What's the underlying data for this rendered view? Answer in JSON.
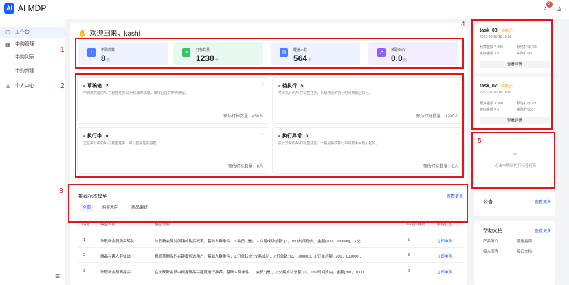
{
  "app": {
    "logo": "AI",
    "name": "AI MDP",
    "notify_count": "2"
  },
  "sidebar": {
    "items": [
      {
        "label": "工作台",
        "icon": "clock-icon"
      },
      {
        "label": "申购管理",
        "icon": "grid-icon"
      },
      {
        "label": "申购列表"
      },
      {
        "label": "申购新建"
      },
      {
        "label": "个人中心",
        "icon": "user-icon"
      }
    ]
  },
  "welcome": "欢迎回来，kashi",
  "stats": [
    {
      "label": "申购次数",
      "value": "8",
      "unit": "次",
      "bg": "#eef3ff",
      "icon_color": "#4d7cfe"
    },
    {
      "label": "打标数量",
      "value": "1230",
      "unit": "个",
      "bg": "#e9f8ef",
      "icon_color": "#34c26b"
    },
    {
      "label": "覆盖人数",
      "value": "564",
      "unit": "个",
      "bg": "#eef3ff",
      "icon_color": "#4d7cfe"
    },
    {
      "label": "关联GMV",
      "value": "0.0",
      "unit": "元",
      "bg": "#f3eefe",
      "icon_color": "#8a63f0"
    }
  ],
  "tasks": [
    {
      "title": "草稿箱",
      "count": "2",
      "desc": "申购未完成的AI-打标签任务,请尽快去草稿箱，审核后提交申购流程。",
      "est": "预估打标数量：450人",
      "dot": "#4d7cfe"
    },
    {
      "title": "待执行",
      "count": "5",
      "desc": "等待执行的AI-打标签任务，系统预设的执行时间到期后执行。",
      "est": "预估打标数量：1200人",
      "dot": "#34c26b"
    },
    {
      "title": "执行中",
      "count": "0",
      "desc": "正在执行中的AI-打标签任务，可以查看任务进度。",
      "est": "预估打标数量：0人",
      "dot": "#4d7cfe"
    },
    {
      "title": "执行异常",
      "count": "0",
      "desc": "执行异常的AI-打标签任务，一般是系统执行中的技术问题引起的。",
      "est": "预估打标数量：0人",
      "dot": "#f04a3a"
    }
  ],
  "recommend": {
    "title": "推荐标签模型",
    "more": "查看更多",
    "tabs": [
      "全部",
      "购买意向",
      "商品偏好"
    ],
    "columns": [
      "序号",
      "模型名称",
      "模型说明",
      "平均打标数",
      "申购状态"
    ],
    "rows": [
      {
        "no": "1",
        "name": "法联新会员购买转化",
        "desc": "法联新会员对店铺的购买概率，基础人群条件：1.会员: [是]；2.交易成功总额: [1，180]时间段内，金额[200，100000]；3.交...",
        "count": "5",
        "action": "立即申购"
      },
      {
        "no": "2",
        "name": "商品兴趣人群优选",
        "desc": "根据某商品的兴趣度优选用户，基础人群条件：1.订单状态: 交易成功；2.订单数: [1，100000]；3.订单总额: [200，100000]；",
        "count": "3",
        "action": "立即申购"
      },
      {
        "no": "3",
        "name": "法联新会员商品兴...",
        "desc": "在法联新会员中根据商品兴趣度进行推荐，基础人群条件：1.会员: [是]；2.交易成功总额: [1，180]时间段内，金额[200，1000...",
        "count": "0",
        "action": "立即申购"
      }
    ]
  },
  "right_tasks": [
    {
      "name": "task_08",
      "tag": "待执行",
      "date": "2023-05-10 18:16:02",
      "l1": "预算金额 ¥ 800",
      "r1": "预估打标 400",
      "l2": "实际金额 ¥ 0",
      "r2": "实际打标 0",
      "btn": "查看详情"
    },
    {
      "name": "task_07",
      "tag": "待执行",
      "date": "2023-05-10 18:16:02",
      "l1": "预算金额 ¥ 500",
      "r1": "预估打标 250",
      "l2": "实际金额 ¥ 0",
      "r2": "实际打标 0",
      "btn": "查看详情"
    }
  ],
  "new_task": {
    "plus": "+",
    "text": "点击申购新的打标签任务"
  },
  "notice": {
    "title": "公告",
    "more": "查看更多"
  },
  "help": {
    "title": "帮助文档",
    "more": "查看更多",
    "items": [
      "产品简介",
      "使用指南",
      "接入流程",
      "接口文档"
    ]
  },
  "annotations": [
    "1",
    "2",
    "3",
    "4",
    "5"
  ]
}
